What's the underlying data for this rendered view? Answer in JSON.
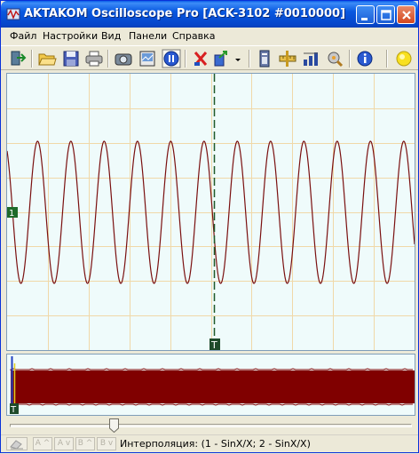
{
  "window": {
    "title": "AKTAKOM Oscilloscope Pro [ACK-3102 #0010000]"
  },
  "menu": {
    "items": [
      {
        "label": "Файл"
      },
      {
        "label": "Настройки"
      },
      {
        "label": "Вид"
      },
      {
        "label": "Панели"
      },
      {
        "label": "Справка"
      }
    ]
  },
  "toolbar": {
    "icons": [
      "exit-icon",
      "open-folder-icon",
      "save-icon",
      "print-icon",
      "camera-icon",
      "snapshot-icon",
      "pause-icon",
      "delete-icon",
      "export-icon",
      "info-icon",
      "ruler-icon",
      "measure-icon",
      "calibrate-icon",
      "about-icon",
      "status-lamp-icon"
    ]
  },
  "scope": {
    "ch_marker": "1",
    "trigger_marker": "T",
    "trace_color": "#7a1010",
    "grid_color": "#f0d8a8",
    "background": "#effbfb"
  },
  "overview": {
    "trigger_marker": "T",
    "fill_color": "#800000"
  },
  "statusbar": {
    "buttons": [
      "A ^",
      "A v",
      "B ^",
      "B v"
    ],
    "text": "Интерполяция: (1 - SinX/X; 2 - SinX/X)"
  }
}
